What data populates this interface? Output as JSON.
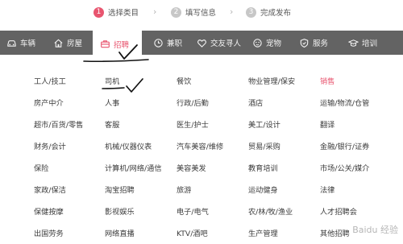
{
  "steps": [
    {
      "num": "1",
      "label": "选择类目",
      "active": true
    },
    {
      "num": "2",
      "label": "填写信息",
      "active": false
    },
    {
      "num": "3",
      "label": "完成发布",
      "active": false
    }
  ],
  "step_arrow": "›",
  "nav": [
    {
      "label": "车辆",
      "icon": "car-icon"
    },
    {
      "label": "房屋",
      "icon": "house-icon"
    },
    {
      "label": "招聘",
      "icon": "briefcase-icon",
      "active": true
    },
    {
      "label": "兼职",
      "icon": "clock-icon"
    },
    {
      "label": "交友寻人",
      "icon": "heart-icon"
    },
    {
      "label": "宠物",
      "icon": "pet-icon"
    },
    {
      "label": "服务",
      "icon": "shield-icon"
    },
    {
      "label": "培训",
      "icon": "graduation-cap-icon"
    }
  ],
  "columns": [
    [
      "工人/技工",
      "房产中介",
      "超市/百货/零售",
      "财务/会计",
      "保险",
      "家政/保洁",
      "保健按摩",
      "出国劳务"
    ],
    [
      "司机",
      "人事",
      "客服",
      "机械/仪器仪表",
      "计算机/网络/通信",
      "淘宝招聘",
      "影视娱乐",
      "网络直播"
    ],
    [
      "餐饮",
      "行政/后勤",
      "医生/护士",
      "汽车美容/维修",
      "美容美发",
      "旅游",
      "电子/电气",
      "KTV/酒吧"
    ],
    [
      "物业管理/保安",
      "酒店",
      "美工/设计",
      "贸易/采购",
      "教育培训",
      "运动健身",
      "农/林/牧/渔业",
      "生产管理"
    ],
    [
      "销售",
      "运输/物流/仓管",
      "翻译",
      "金融/银行/证券",
      "市场/公关/媒介",
      "法律",
      "人才招聘会",
      "其他招聘"
    ]
  ],
  "highlight": {
    "column": 4,
    "row": 0,
    "color": "#e8556f"
  },
  "watermark": "Baidu 经验",
  "colors": {
    "accent": "#e8556f",
    "nav_bg": "#636363",
    "step_inactive": "#c7c7c7"
  }
}
